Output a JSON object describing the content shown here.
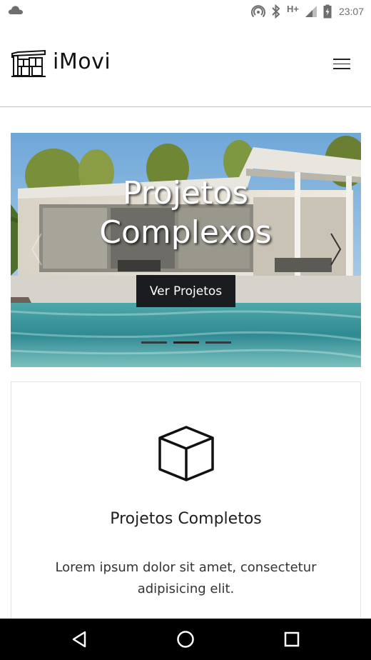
{
  "status_bar": {
    "left_icons": [
      "cloud-icon"
    ],
    "right_icons": [
      "hotspot-icon",
      "bluetooth-icon",
      "signal-icon",
      "battery-charging-icon"
    ],
    "network_type": "H+",
    "time": "23:07"
  },
  "header": {
    "brand": "iMovi",
    "logo_icon": "house-logo-icon",
    "menu_icon": "hamburger-menu-icon"
  },
  "carousel": {
    "slide_title_line1": "Projetos",
    "slide_title_line2": "Complexos",
    "cta_label": "Ver Projetos",
    "next_icon": "chevron-right-icon",
    "prev_icon": "chevron-left-icon",
    "slide_count": 3,
    "active_slide": 2
  },
  "feature_card": {
    "icon": "cube-icon",
    "title": "Projetos Completos",
    "text": "Lorem ipsum dolor sit amet, consectetur adipisicing elit."
  },
  "nav_bar": {
    "buttons": [
      "back-icon",
      "home-icon",
      "recents-icon"
    ]
  }
}
